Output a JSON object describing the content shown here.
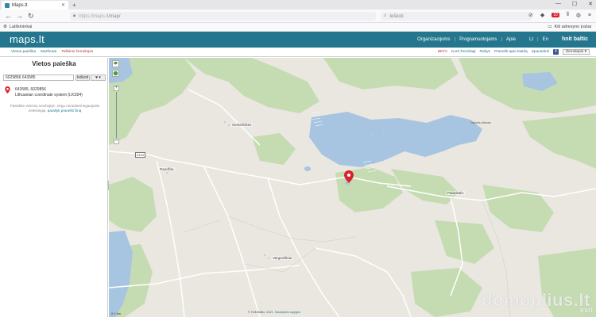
{
  "browser": {
    "tab_title": "Maps.lt",
    "url_host": "https://maps.lt",
    "url_path": "/map/",
    "search_placeholder": "Ieškoti",
    "bookmarks_left": "Laiškininkai",
    "bookmarks_right": "Kiti adresyno įrašai",
    "badge": "10"
  },
  "site": {
    "logo": "maps.lt",
    "nav": [
      "Organizacijoms",
      "Programuotojams",
      "Apie"
    ],
    "lang_lt": "Lt",
    "lang_en": "En",
    "partner": "hnit baltic"
  },
  "subnav": {
    "left": [
      "Vietos paieška",
      "Maršrutai",
      "Taškinis žemėlapis"
    ],
    "active_index": 2,
    "right": [
      "BETA",
      "Kurti žemėlapį",
      "Rašyti",
      "Pranešti apie klaidą",
      "Spausdinti"
    ],
    "map_selector": "Žemėlapis"
  },
  "sidebar": {
    "title": "Vietos paieška",
    "search_value": "6029856 643585",
    "search_button": "Ieškoti",
    "result_coords": "643585, 6029856",
    "result_system": "Lithuanian coordinate system (LKS94)",
    "hint_text": "Pasiekite vietovių neužsipyk. Jeigu neradote/negautysite neteisingai,",
    "hint_link": "parašyk pranešti žiną"
  },
  "map": {
    "labels": {
      "place1": "Serbežiškės",
      "place2": "Raudžiai",
      "place3": "Palaukalis",
      "place4": "Vargeniškiai",
      "lake": "Galvės ežeras",
      "road": "4124"
    },
    "scale_text": "0 1 km",
    "attribution": "© Hnit-Baltic, 2021.",
    "attribution_link": "Naudojimo sąlygos"
  },
  "watermark": "domoplius.lt",
  "esri": "esri",
  "colors": {
    "header": "#23768e",
    "water": "#a7c5e0",
    "forest": "#c5dcb2",
    "land": "#e9e7e0",
    "pin": "#d9232e"
  }
}
